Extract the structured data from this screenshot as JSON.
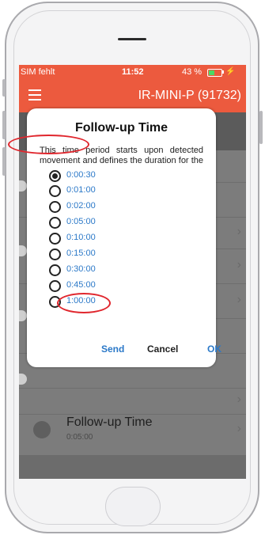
{
  "statusbar": {
    "carrier": "SIM fehlt",
    "time": "11:52",
    "battery": "43 %"
  },
  "navbar": {
    "title": "IR-MINI-P  (91732)"
  },
  "toolbar": {
    "left_icon": "repeat-icon",
    "right_icon": "play-icon"
  },
  "background_list": {
    "followup_title": "Follow-up Time",
    "followup_value": "0:05:00"
  },
  "dialog": {
    "title": "Follow-up Time",
    "message": "This time period starts upon detected movement and defines the duration for the",
    "options": [
      "0:00:30",
      "0:01:00",
      "0:02:00",
      "0:05:00",
      "0:10:00",
      "0:15:00",
      "0:30:00",
      "0:45:00",
      "1:00:00"
    ],
    "selected": "0:00:30",
    "buttons": {
      "send": "Send",
      "cancel": "Cancel",
      "ok": "OK"
    }
  },
  "colors": {
    "accent": "#ec5a3e",
    "link": "#2a78c8",
    "highlight": "#e0262d"
  }
}
